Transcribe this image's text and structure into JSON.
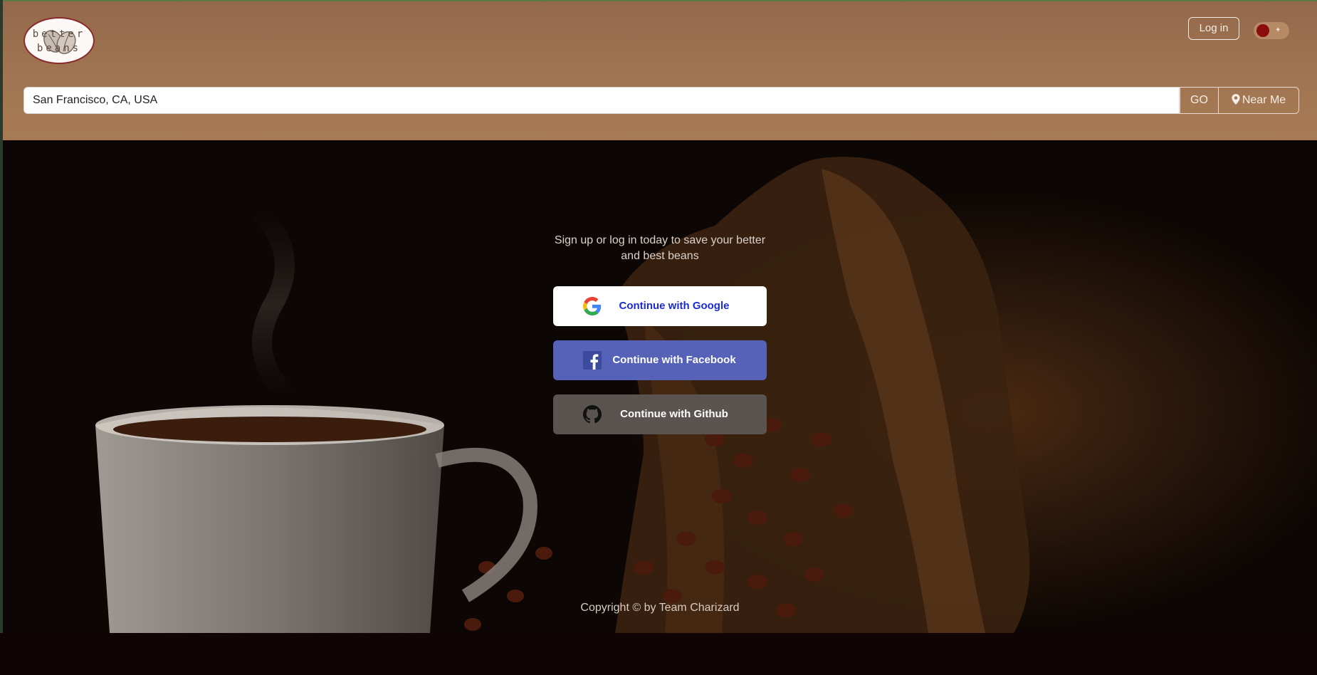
{
  "header": {
    "logo": {
      "line1": "better",
      "line2": "beans"
    },
    "login_label": "Log in",
    "theme_toggle_icon": "sun-icon"
  },
  "search": {
    "value": "San Francisco, CA, USA",
    "go_label": "GO",
    "near_me_label": "Near Me",
    "near_me_icon": "map-marker-icon"
  },
  "hero": {
    "tagline_line1": "Sign up or log in today to save your better",
    "tagline_line2": "and best beans",
    "buttons": [
      {
        "label": "Continue with Google",
        "icon": "google-icon",
        "color": "#ffffff",
        "text_color": "#1a2bd6"
      },
      {
        "label": "Continue with Facebook",
        "icon": "facebook-icon",
        "color": "#5661b8",
        "text_color": "#ffffff"
      },
      {
        "label": "Continue with Github",
        "icon": "github-icon",
        "color": "#5a5350",
        "text_color": "#ffffff"
      }
    ],
    "copyright": "Copyright © by Team Charizard"
  },
  "colors": {
    "header_bg": "#a27652",
    "accent_red": "#8b0d0d",
    "page_bottom": "#110404"
  }
}
